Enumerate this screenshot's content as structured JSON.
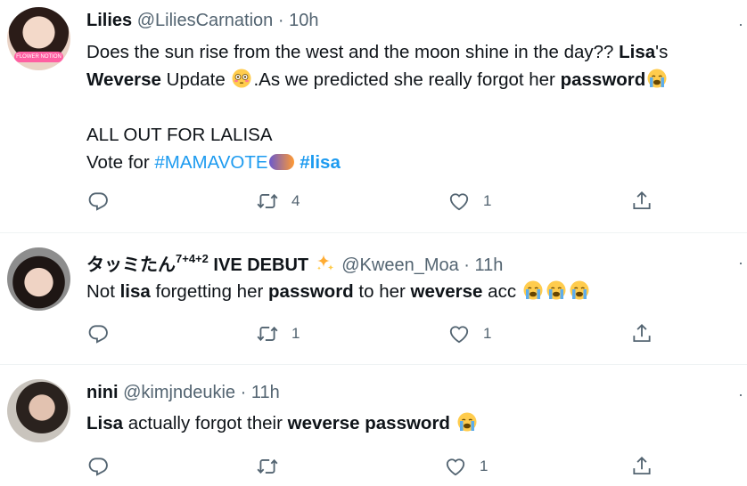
{
  "tweets": [
    {
      "name": "Lilies",
      "handle": "@LiliesCarnation",
      "time": "10h",
      "avatar_caption": "FLOWER NOTION",
      "lines": {
        "l1_a": "Does the sun rise from the west and the moon shine in the day?? ",
        "l1_b": "Lisa",
        "l1_c": "'s",
        "l2_a": "Weverse",
        "l2_b": " Update ",
        "l2_c": ".As we predicted she really forgot her ",
        "l2_d": "password",
        "l3": "ALL OUT FOR LALISA",
        "l4_a": "Vote for ",
        "l4_tag1": "#MAMAVOTE",
        "l4_tag2": "#lisa"
      },
      "replies": "",
      "retweets": "4",
      "likes": "1"
    },
    {
      "name_a": "タッミたん",
      "name_sup": "7+4+2",
      "name_b": " IVE DEBUT ",
      "handle": "@Kween_Moa",
      "time": "11h",
      "lines": {
        "a": "Not ",
        "b": "lisa",
        "c": " forgetting her ",
        "d": "password",
        "e": " to her ",
        "f": "weverse",
        "g": " acc "
      },
      "replies": "",
      "retweets": "1",
      "likes": "1"
    },
    {
      "name": "nini",
      "handle": "@kimjndeukie",
      "time": "11h",
      "lines": {
        "a": "Lisa",
        "b": " actually forgot their ",
        "c": "weverse password",
        "d": " "
      },
      "replies": "",
      "retweets": "",
      "likes": "1"
    }
  ],
  "separator": "·",
  "more_glyph": "·",
  "colors": {
    "link": "#1d9bf0",
    "secondary": "#536471",
    "divider": "#eff3f4"
  },
  "icons": [
    "reply-icon",
    "retweet-icon",
    "like-icon",
    "share-icon",
    "loudly-crying-face-icon",
    "flushed-face-icon",
    "sparkles-icon"
  ]
}
